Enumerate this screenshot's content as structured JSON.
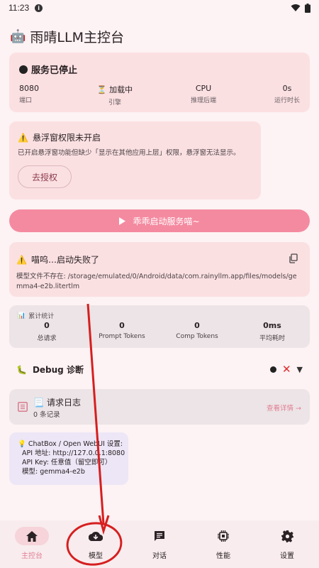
{
  "status_bar": {
    "time": "11:23",
    "info_glyph": "i"
  },
  "app": {
    "title": "雨晴LLM主控台",
    "icon": "robot-icon"
  },
  "service": {
    "title": "服务已停止",
    "stats": [
      {
        "value": "8080",
        "label": "端口"
      },
      {
        "value": "加载中",
        "label": "引擎"
      },
      {
        "value": "CPU",
        "label": "推理后端"
      },
      {
        "value": "0s",
        "label": "运行时长"
      }
    ]
  },
  "permission": {
    "title": "悬浮窗权限未开启",
    "description": "已开启悬浮窗功能但缺少「显示在其他应用上层」权限，悬浮窗无法显示。",
    "button": "去授权"
  },
  "start_button": {
    "label": "乖乖启动服务喵~"
  },
  "error": {
    "title": "喵呜…启动失败了",
    "description": "模型文件不存在: /storage/emulated/0/Android/data/com.rainyllm.app/files/models/gemma4-e2b.litertlm"
  },
  "stats": {
    "title": "累计统计",
    "items": [
      {
        "value": "0",
        "label": "总请求"
      },
      {
        "value": "0",
        "label": "Prompt Tokens"
      },
      {
        "value": "0",
        "label": "Comp Tokens"
      },
      {
        "value": "0ms",
        "label": "平均耗时"
      }
    ]
  },
  "debug": {
    "title": "Debug 诊断"
  },
  "logs": {
    "title": "请求日志",
    "count": "0 条记录",
    "link": "查看详情 →"
  },
  "tip": {
    "lines": [
      "ChatBox / Open WebUI 设置:",
      "API 地址: http://127.0.0.1:8080",
      "API Key: 任意值（留空即可）",
      "模型: gemma4-e2b"
    ]
  },
  "nav": [
    {
      "label": "主控台",
      "icon": "home-icon",
      "active": true
    },
    {
      "label": "模型",
      "icon": "cloud-download-icon",
      "active": false
    },
    {
      "label": "对话",
      "icon": "chat-icon",
      "active": false
    },
    {
      "label": "性能",
      "icon": "chip-icon",
      "active": false
    },
    {
      "label": "设置",
      "icon": "gear-icon",
      "active": false
    }
  ],
  "colors": {
    "accent": "#e17e94",
    "start_button": "#f48aa0",
    "card_pink": "#fbe0e2",
    "annotation_red": "#d61f1f"
  }
}
